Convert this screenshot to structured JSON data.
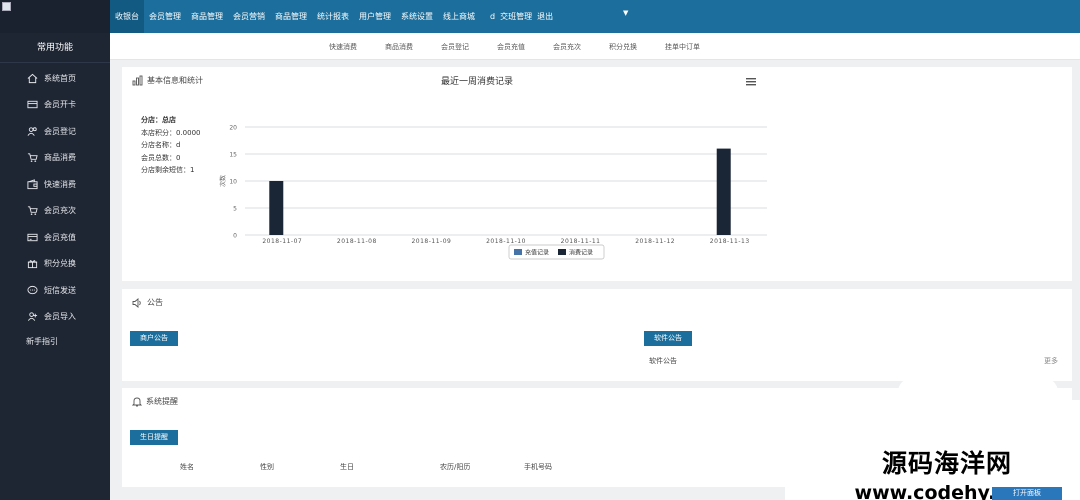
{
  "topbar": {
    "nav": [
      "收银台",
      "会员管理",
      "商品管理",
      "会员营销",
      "商品管理",
      "统计报表",
      "用户管理",
      "系统设置",
      "线上商城"
    ],
    "user": "d",
    "shop_manage": "交班管理",
    "logout": "退出"
  },
  "sidebar": {
    "header": "常用功能",
    "items": [
      {
        "label": "系统首页",
        "icon": "home-icon"
      },
      {
        "label": "会员开卡",
        "icon": "card-icon"
      },
      {
        "label": "会员登记",
        "icon": "users-icon"
      },
      {
        "label": "商品消费",
        "icon": "cart-icon"
      },
      {
        "label": "快速消费",
        "icon": "wallet-icon"
      },
      {
        "label": "会员充次",
        "icon": "cart-icon"
      },
      {
        "label": "会员充值",
        "icon": "credit-card-icon"
      },
      {
        "label": "积分兑换",
        "icon": "gift-icon"
      },
      {
        "label": "短信发送",
        "icon": "chat-icon"
      },
      {
        "label": "会员导入",
        "icon": "user-import-icon"
      }
    ],
    "guide": "新手指引"
  },
  "subnav": [
    "快速消费",
    "商品消费",
    "会员登记",
    "会员充值",
    "会员充次",
    "积分兑换",
    "挂单中订单"
  ],
  "basic_panel": {
    "title": "基本信息和统计",
    "stats": [
      "分店：总店",
      "本店积分：0.0000",
      "分店名称：d",
      "会员总数：0",
      "分店剩余短信：1"
    ]
  },
  "chart_data": {
    "type": "bar",
    "title": "最近一周消费记录",
    "categories": [
      "2018-11-07",
      "2018-11-08",
      "2018-11-09",
      "2018-11-10",
      "2018-11-11",
      "2018-11-12",
      "2018-11-13"
    ],
    "series": [
      {
        "name": "充值记录",
        "values": [
          0,
          0,
          0,
          0,
          0,
          0,
          0
        ],
        "color": "#4572a7"
      },
      {
        "name": "消费记录",
        "values": [
          10,
          0,
          0,
          0,
          0,
          0,
          16
        ],
        "color": "#1a2535"
      }
    ],
    "yticks": [
      "0",
      "5",
      "10",
      "15",
      "20"
    ],
    "ylim": [
      0,
      20
    ],
    "ylabel": "次数",
    "grid": true,
    "legend": "bottom",
    "menu_icon": "menu-icon"
  },
  "notice_panel": {
    "title": "公告",
    "shop_notice_button": "商户公告",
    "software_notice_button": "软件公告",
    "software_notice_text": "软件公告",
    "more": "更多"
  },
  "reminder_panel": {
    "title": "系统提醒",
    "birthday_button": "生日提醒",
    "columns": [
      "姓名",
      "性别",
      "生日",
      "农历/阳历",
      "手机号码"
    ]
  },
  "watermark": {
    "line1": "源码海洋网",
    "line2": "www.codehy.com"
  },
  "corner_button": "打开面板",
  "colors": {
    "topbar": "#1c6f9c",
    "sidebar": "#1f2633",
    "button": "#1c6f9c"
  }
}
